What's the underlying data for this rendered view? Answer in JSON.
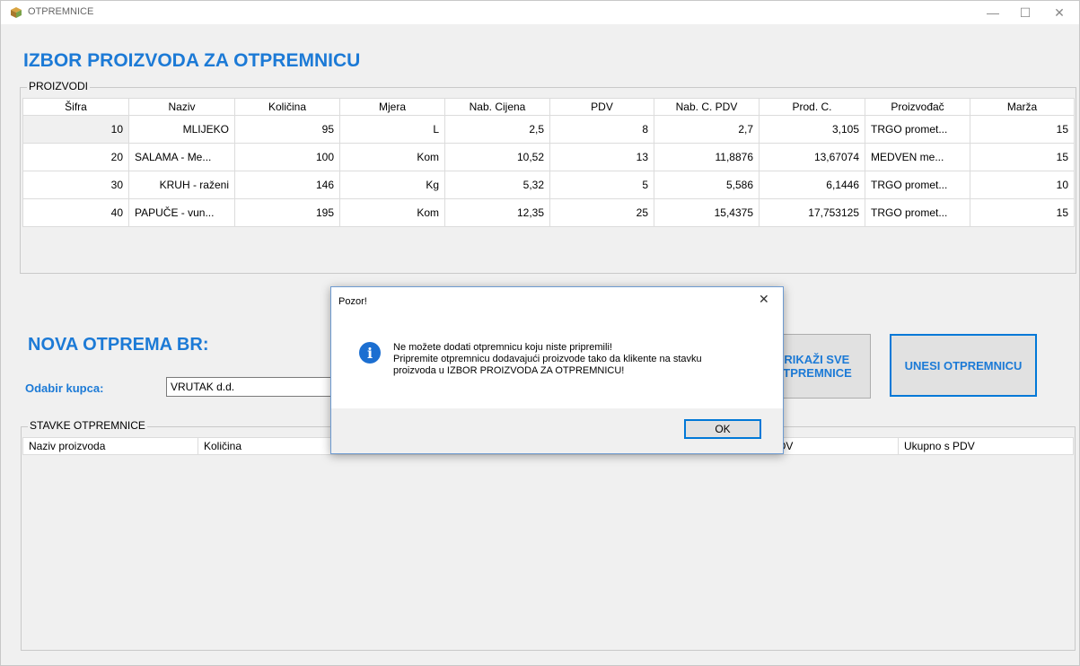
{
  "window": {
    "title": "OTPREMNICE",
    "minimize": "—",
    "maximize": "☐",
    "close": "✕"
  },
  "header": {
    "title": "IZBOR PROIZVODA ZA OTPREMNICU"
  },
  "products": {
    "group_label": "PROIZVODI",
    "columns": [
      "Šifra",
      "Naziv",
      "Količina",
      "Mjera",
      "Nab. Cijena",
      "PDV",
      "Nab. C. PDV",
      "Prod. C.",
      "Proizvođač",
      "Marža"
    ],
    "rows": [
      [
        "10",
        "MLIJEKO",
        "95",
        "L",
        "2,5",
        "8",
        "2,7",
        "3,105",
        "TRGO promet...",
        "15"
      ],
      [
        "20",
        "SALAMA - Me...",
        "100",
        "Kom",
        "10,52",
        "13",
        "11,8876",
        "13,67074",
        "MEDVEN me...",
        "15"
      ],
      [
        "30",
        "KRUH - raženi",
        "146",
        "Kg",
        "5,32",
        "5",
        "5,586",
        "6,1446",
        "TRGO promet...",
        "10"
      ],
      [
        "40",
        "PAPUČE - vun...",
        "195",
        "Kom",
        "12,35",
        "25",
        "15,4375",
        "17,753125",
        "TRGO promet...",
        "15"
      ]
    ]
  },
  "new_shipment": {
    "title": "NOVA OTPREMA BR:",
    "customer_label": "Odabir kupca:",
    "customer_value": "VRUTAK d.d.",
    "show_all_label": "PRIKAŽI SVE OTPREMNICE",
    "enter_label": "UNESI OTPREMNICU"
  },
  "items": {
    "group_label": "STAVKE OTPREMNICE",
    "columns": [
      "Naziv proizvoda",
      "Količina",
      "",
      "",
      "Cijena s PDV",
      "Ukupno s PDV"
    ]
  },
  "dialog": {
    "title": "Pozor!",
    "close": "✕",
    "icon_glyph": "i",
    "message_line1": "Ne možete dodati otpremnicu koju niste pripremili!",
    "message_line2": "Pripremite otpremnicu dodavajući proizvode tako da klikente na stavku",
    "message_line3": "proizvoda u IZBOR PROIZVODA ZA OTPREMNICU!",
    "ok_label": "OK"
  },
  "colors": {
    "accent": "#1c7ad6",
    "dialog_border": "#6e9bd1",
    "ok_border": "#0078d7"
  }
}
